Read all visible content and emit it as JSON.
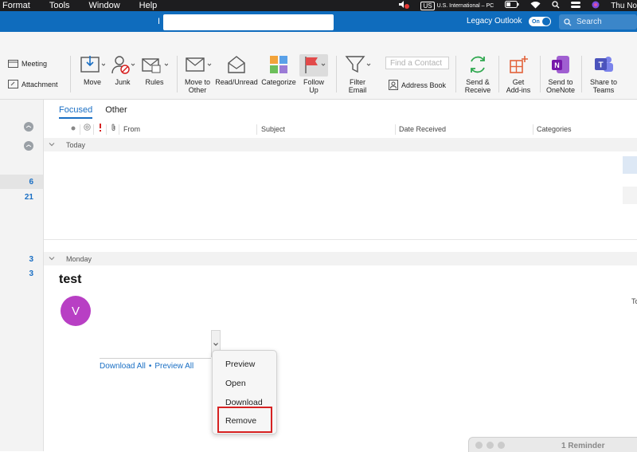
{
  "menubar": {
    "items": [
      "Format",
      "Tools",
      "Window",
      "Help"
    ],
    "keyboard_badge": "US",
    "input_source": "U.S. International – PC",
    "clock": "Thu No"
  },
  "titlebar": {
    "title_prefix": "I",
    "legacy_label": "Legacy Outlook",
    "toggle_label": "On",
    "search_placeholder": "Search"
  },
  "ribbon": {
    "meeting": "Meeting",
    "attachment": "Attachment",
    "move": "Move",
    "junk": "Junk",
    "rules": "Rules",
    "move_to_other_1": "Move to",
    "move_to_other_2": "Other",
    "read_unread": "Read/Unread",
    "categorize": "Categorize",
    "follow_up_1": "Follow",
    "follow_up_2": "Up",
    "filter_email_1": "Filter",
    "filter_email_2": "Email",
    "find_contact_placeholder": "Find a Contact",
    "address_book": "Address Book",
    "send_receive_1": "Send &",
    "send_receive_2": "Receive",
    "get_addins_1": "Get",
    "get_addins_2": "Add-ins",
    "send_onenote_1": "Send to",
    "send_onenote_2": "OneNote",
    "share_teams_1": "Share to",
    "share_teams_2": "Teams"
  },
  "leftrail": {
    "counts": [
      "6",
      "21",
      "3",
      "3"
    ]
  },
  "tabs": {
    "focused": "Focused",
    "other": "Other"
  },
  "columns": {
    "from": "From",
    "subject": "Subject",
    "date_received": "Date Received",
    "categories": "Categories"
  },
  "groups": {
    "today": "Today",
    "monday": "Monday"
  },
  "message": {
    "subject": "test",
    "avatar_initial": "V",
    "to_label": "To",
    "download_all": "Download All",
    "separator": "•",
    "preview_all": "Preview All"
  },
  "context_menu": {
    "items": [
      "Preview",
      "Open",
      "Download",
      "Remove"
    ],
    "highlighted": "Remove",
    "highlight_color": "#d62222"
  },
  "reminder": {
    "title": "1 Reminder"
  },
  "colors": {
    "title_bar": "#0f6cbd",
    "accent": "#1a6fc4",
    "avatar": "#b83fc4"
  }
}
